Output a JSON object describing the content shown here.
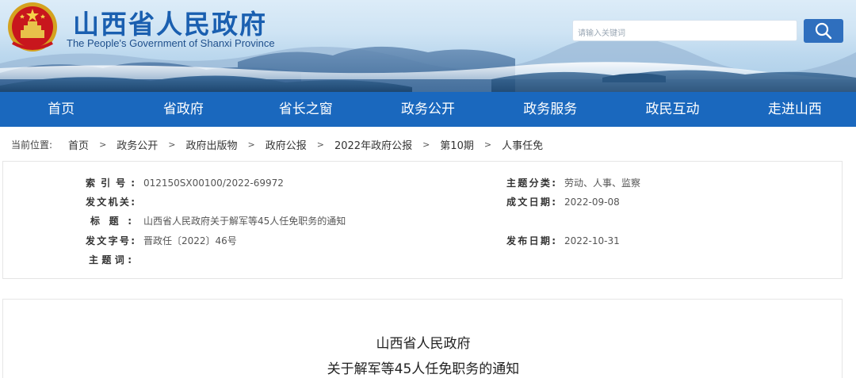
{
  "header": {
    "title": "山西省人民政府",
    "subtitle": "The People's Government of Shanxi Province",
    "emblem_icon": "national-emblem-icon",
    "search": {
      "placeholder": "请输入关键词",
      "button_icon": "search-icon"
    }
  },
  "nav": {
    "items": [
      {
        "label": "首页"
      },
      {
        "label": "省政府"
      },
      {
        "label": "省长之窗"
      },
      {
        "label": "政务公开"
      },
      {
        "label": "政务服务"
      },
      {
        "label": "政民互动"
      },
      {
        "label": "走进山西"
      }
    ]
  },
  "breadcrumb": {
    "label": "当前位置:",
    "separator": ">",
    "items": [
      "首页",
      "政务公开",
      "政府出版物",
      "政府公报",
      "2022年政府公报",
      "第10期",
      "人事任免"
    ]
  },
  "meta": {
    "index_no": {
      "key": "索引号:",
      "value": "012150SX00100/2022-69972"
    },
    "issuer": {
      "key": "发文机关:",
      "value": ""
    },
    "title": {
      "key": "标题:",
      "value": "山西省人民政府关于解军等45人任免职务的通知"
    },
    "doc_no": {
      "key": "发文字号:",
      "value": "晋政任〔2022〕46号"
    },
    "subject_words": {
      "key": "主题词:",
      "value": ""
    },
    "category": {
      "key": "主题分类:",
      "value": "劳动、人事、监察"
    },
    "created": {
      "key": "成文日期:",
      "value": "2022-09-08"
    },
    "published": {
      "key": "发布日期:",
      "value": "2022-10-31"
    }
  },
  "article": {
    "title_line1": "山西省人民政府",
    "title_line2": "关于解军等45人任免职务的通知"
  },
  "colors": {
    "nav_bg": "#1a68be",
    "title_blue": "#1a5fb0",
    "search_button": "#2f6fbe"
  }
}
